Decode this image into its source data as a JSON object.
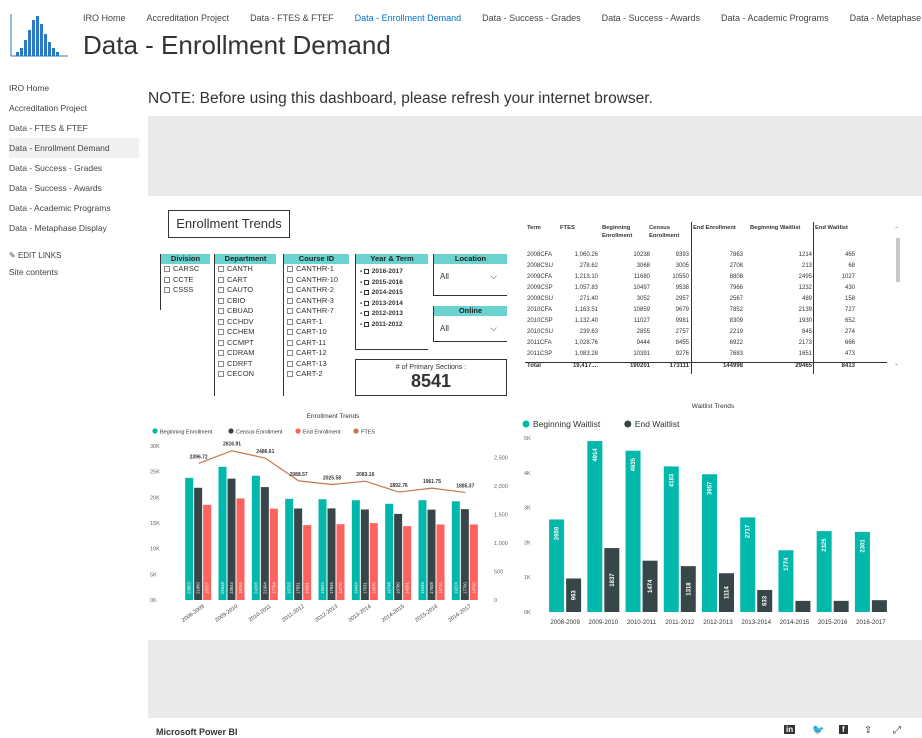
{
  "nav": {
    "links": [
      "IRO Home",
      "Accreditation Project",
      "Data - FTES & FTEF",
      "Data - Enrollment Demand",
      "Data - Success - Grades",
      "Data - Success - Awards",
      "Data - Academic Programs",
      "Data - Metaphase Display"
    ],
    "active_index": 3,
    "page_title": "Data - Enrollment Demand"
  },
  "sidebar": {
    "items": [
      "IRO Home",
      "Accreditation Project",
      "Data - FTES & FTEF",
      "Data - Enrollment Demand",
      "Data - Success - Grades",
      "Data - Success - Awards",
      "Data - Academic Programs",
      "Data - Metaphase Display"
    ],
    "active_index": 3,
    "edit_links": "EDIT LINKS",
    "site_contents": "Site contents"
  },
  "note": "NOTE: Before using this dashboard, please refresh your internet browser.",
  "report": {
    "enrollment_trends_title": "Enrollment Trends",
    "slicers": {
      "division": {
        "header": "Division",
        "options": [
          "CARSC",
          "CCTE",
          "CSSS"
        ]
      },
      "department": {
        "header": "Department",
        "options": [
          "CANTH",
          "CART",
          "CAUTO",
          "CBIO",
          "CBUAD",
          "CCHDV",
          "CCHEM",
          "CCMPT",
          "CDRAM",
          "CDRFT",
          "CECON"
        ]
      },
      "course": {
        "header": "Course ID",
        "options": [
          "CANTHR-1",
          "CANTHR-10",
          "CANTHR-2",
          "CANTHR-3",
          "CANTHR-7",
          "CART-1",
          "CART-10",
          "CART-11",
          "CART-12",
          "CART-13",
          "CART-2"
        ]
      },
      "year_term": {
        "header": "Year & Term",
        "options": [
          "2016-2017",
          "2015-2016",
          "2014-2015",
          "2013-2014",
          "2012-2013",
          "2011-2012"
        ]
      },
      "location": {
        "header": "Location",
        "value": "All"
      },
      "online": {
        "header": "Online",
        "value": "All"
      }
    },
    "card": {
      "label": "# of Primary Sections :",
      "value": "8541"
    },
    "table": {
      "columns": [
        "Term",
        "FTES",
        "Beginning Enrollment",
        "Census Enrollment",
        "End Enrollment",
        "Beginning Waitlist",
        "End Waitlist"
      ],
      "rows": [
        [
          "2008CFA",
          "1,060.26",
          "10238",
          "9393",
          "7863",
          "1214",
          "465"
        ],
        [
          "2008CSU",
          "278.62",
          "3068",
          "3005",
          "2708",
          "213",
          "68"
        ],
        [
          "2009CFA",
          "1,213.10",
          "11680",
          "10550",
          "8808",
          "2495",
          "1027"
        ],
        [
          "2009CSP",
          "1,057.83",
          "10497",
          "9538",
          "7966",
          "1232",
          "430"
        ],
        [
          "2009CSU",
          "271.40",
          "3052",
          "2957",
          "2567",
          "489",
          "158"
        ],
        [
          "2010CFA",
          "1,163.51",
          "10859",
          "9679",
          "7852",
          "2139",
          "727"
        ],
        [
          "2010CSP",
          "1,132.40",
          "11027",
          "9981",
          "8309",
          "1930",
          "652"
        ],
        [
          "2010CSU",
          "239.63",
          "2855",
          "2757",
          "2219",
          "845",
          "274"
        ],
        [
          "2011CFA",
          "1,028.76",
          "9444",
          "8455",
          "6922",
          "2173",
          "666"
        ],
        [
          "2011CSP",
          "1,083.28",
          "10391",
          "9276",
          "7683",
          "1651",
          "473"
        ]
      ],
      "total": [
        "Total",
        "19,417....",
        "190201",
        "173111",
        "144998",
        "29465",
        "8413"
      ]
    }
  },
  "chart_data": [
    {
      "type": "bar",
      "title": "Enrollment Trends",
      "categories": [
        "2008-2009",
        "2009-2010",
        "2010-2011",
        "2011-2012",
        "2012-2013",
        "2013-2014",
        "2014-2015",
        "2015-2016",
        "2016-2017"
      ],
      "series": [
        {
          "name": "Beginning Enrollment",
          "color": "#01b8aa",
          "values": [
            23803,
            25948,
            24205,
            19703,
            19624,
            19434,
            18748,
            19439,
            19224
          ]
        },
        {
          "name": "Census Enrollment",
          "color": "#374649",
          "values": [
            21860,
            23644,
            21994,
            17831,
            17846,
            17631,
            16780,
            17608,
            17700
          ]
        },
        {
          "name": "End Enrollment",
          "color": "#fd625e",
          "values": [
            18537,
            19793,
            17794,
            14591,
            14770,
            14970,
            14391,
            14710,
            14720
          ]
        },
        {
          "name": "FTES",
          "color": "#c5794a",
          "type": "line",
          "values": [
            2396.72,
            2616.91,
            2486.61,
            2088.57,
            2025.58,
            2083.16,
            1892.76,
            1961.75,
            1885.37
          ]
        }
      ],
      "y_ticks": [
        "0K",
        "5K",
        "10K",
        "15K",
        "20K",
        "25K",
        "30K"
      ],
      "y2_ticks": [
        "0",
        "500",
        "1,000",
        "1,500",
        "2,000",
        "2,500"
      ],
      "ylim": [
        0,
        30000
      ],
      "y2lim": [
        0,
        2700
      ],
      "legend": "top-left"
    },
    {
      "type": "bar",
      "title": "Waitlist Trends",
      "categories": [
        "2008-2009",
        "2009-2010",
        "2010-2011",
        "2011-2012",
        "2012-2013",
        "2013-2014",
        "2014-2015",
        "2015-2016",
        "2016-2017"
      ],
      "series": [
        {
          "name": "Beginning Waitlist",
          "color": "#01b8aa",
          "values": [
            2659,
            4914,
            4635,
            4183,
            3957,
            2717,
            1774,
            2325,
            2301
          ]
        },
        {
          "name": "End Waitlist",
          "color": "#374649",
          "values": [
            963,
            1837,
            1474,
            1318,
            1114,
            633,
            320,
            320,
            340
          ]
        }
      ],
      "y_ticks": [
        "0K",
        "1K",
        "2K",
        "3K",
        "4K",
        "5K"
      ],
      "ylim": [
        0,
        5000
      ],
      "legend": "top-left"
    }
  ],
  "footer": {
    "brand": "Microsoft Power BI"
  },
  "colors": {
    "teal": "#01b8aa",
    "dark": "#374649",
    "red": "#fd625e",
    "ftes": "#c5794a",
    "accent": "#0072c6"
  }
}
